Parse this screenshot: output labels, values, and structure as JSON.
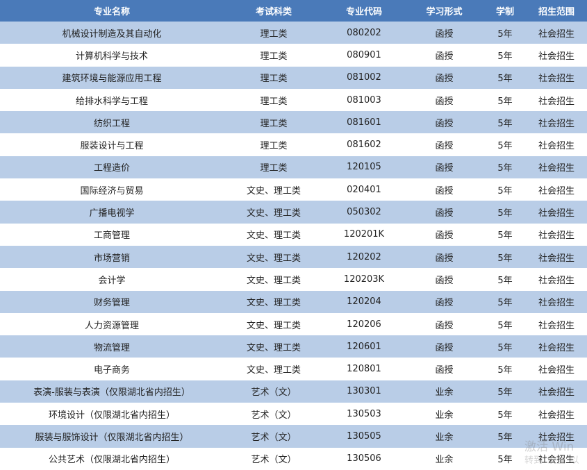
{
  "headers": [
    "专业名称",
    "考试科类",
    "专业代码",
    "学习形式",
    "学制",
    "招生范围"
  ],
  "rows": [
    [
      "机械设计制造及其自动化",
      "理工类",
      "080202",
      "函授",
      "5年",
      "社会招生"
    ],
    [
      "计算机科学与技术",
      "理工类",
      "080901",
      "函授",
      "5年",
      "社会招生"
    ],
    [
      "建筑环境与能源应用工程",
      "理工类",
      "081002",
      "函授",
      "5年",
      "社会招生"
    ],
    [
      "给排水科学与工程",
      "理工类",
      "081003",
      "函授",
      "5年",
      "社会招生"
    ],
    [
      "纺织工程",
      "理工类",
      "081601",
      "函授",
      "5年",
      "社会招生"
    ],
    [
      "服装设计与工程",
      "理工类",
      "081602",
      "函授",
      "5年",
      "社会招生"
    ],
    [
      "工程造价",
      "理工类",
      "120105",
      "函授",
      "5年",
      "社会招生"
    ],
    [
      "国际经济与贸易",
      "文史、理工类",
      "020401",
      "函授",
      "5年",
      "社会招生"
    ],
    [
      "广播电视学",
      "文史、理工类",
      "050302",
      "函授",
      "5年",
      "社会招生"
    ],
    [
      "工商管理",
      "文史、理工类",
      "120201K",
      "函授",
      "5年",
      "社会招生"
    ],
    [
      "市场营销",
      "文史、理工类",
      "120202",
      "函授",
      "5年",
      "社会招生"
    ],
    [
      "会计学",
      "文史、理工类",
      "120203K",
      "函授",
      "5年",
      "社会招生"
    ],
    [
      "财务管理",
      "文史、理工类",
      "120204",
      "函授",
      "5年",
      "社会招生"
    ],
    [
      "人力资源管理",
      "文史、理工类",
      "120206",
      "函授",
      "5年",
      "社会招生"
    ],
    [
      "物流管理",
      "文史、理工类",
      "120601",
      "函授",
      "5年",
      "社会招生"
    ],
    [
      "电子商务",
      "文史、理工类",
      "120801",
      "函授",
      "5年",
      "社会招生"
    ],
    [
      "表演-服装与表演（仅限湖北省内招生）",
      "艺术（文）",
      "130301",
      "业余",
      "5年",
      "社会招生"
    ],
    [
      "环境设计（仅限湖北省内招生）",
      "艺术（文）",
      "130503",
      "业余",
      "5年",
      "社会招生"
    ],
    [
      "服装与服饰设计（仅限湖北省内招生）",
      "艺术（文）",
      "130505",
      "业余",
      "5年",
      "社会招生"
    ],
    [
      "公共艺术（仅限湖北省内招生）",
      "艺术（文）",
      "130506",
      "业余",
      "5年",
      "社会招生"
    ]
  ],
  "watermark": {
    "line1": "激活 Win",
    "line2": "转到“设置”以"
  }
}
